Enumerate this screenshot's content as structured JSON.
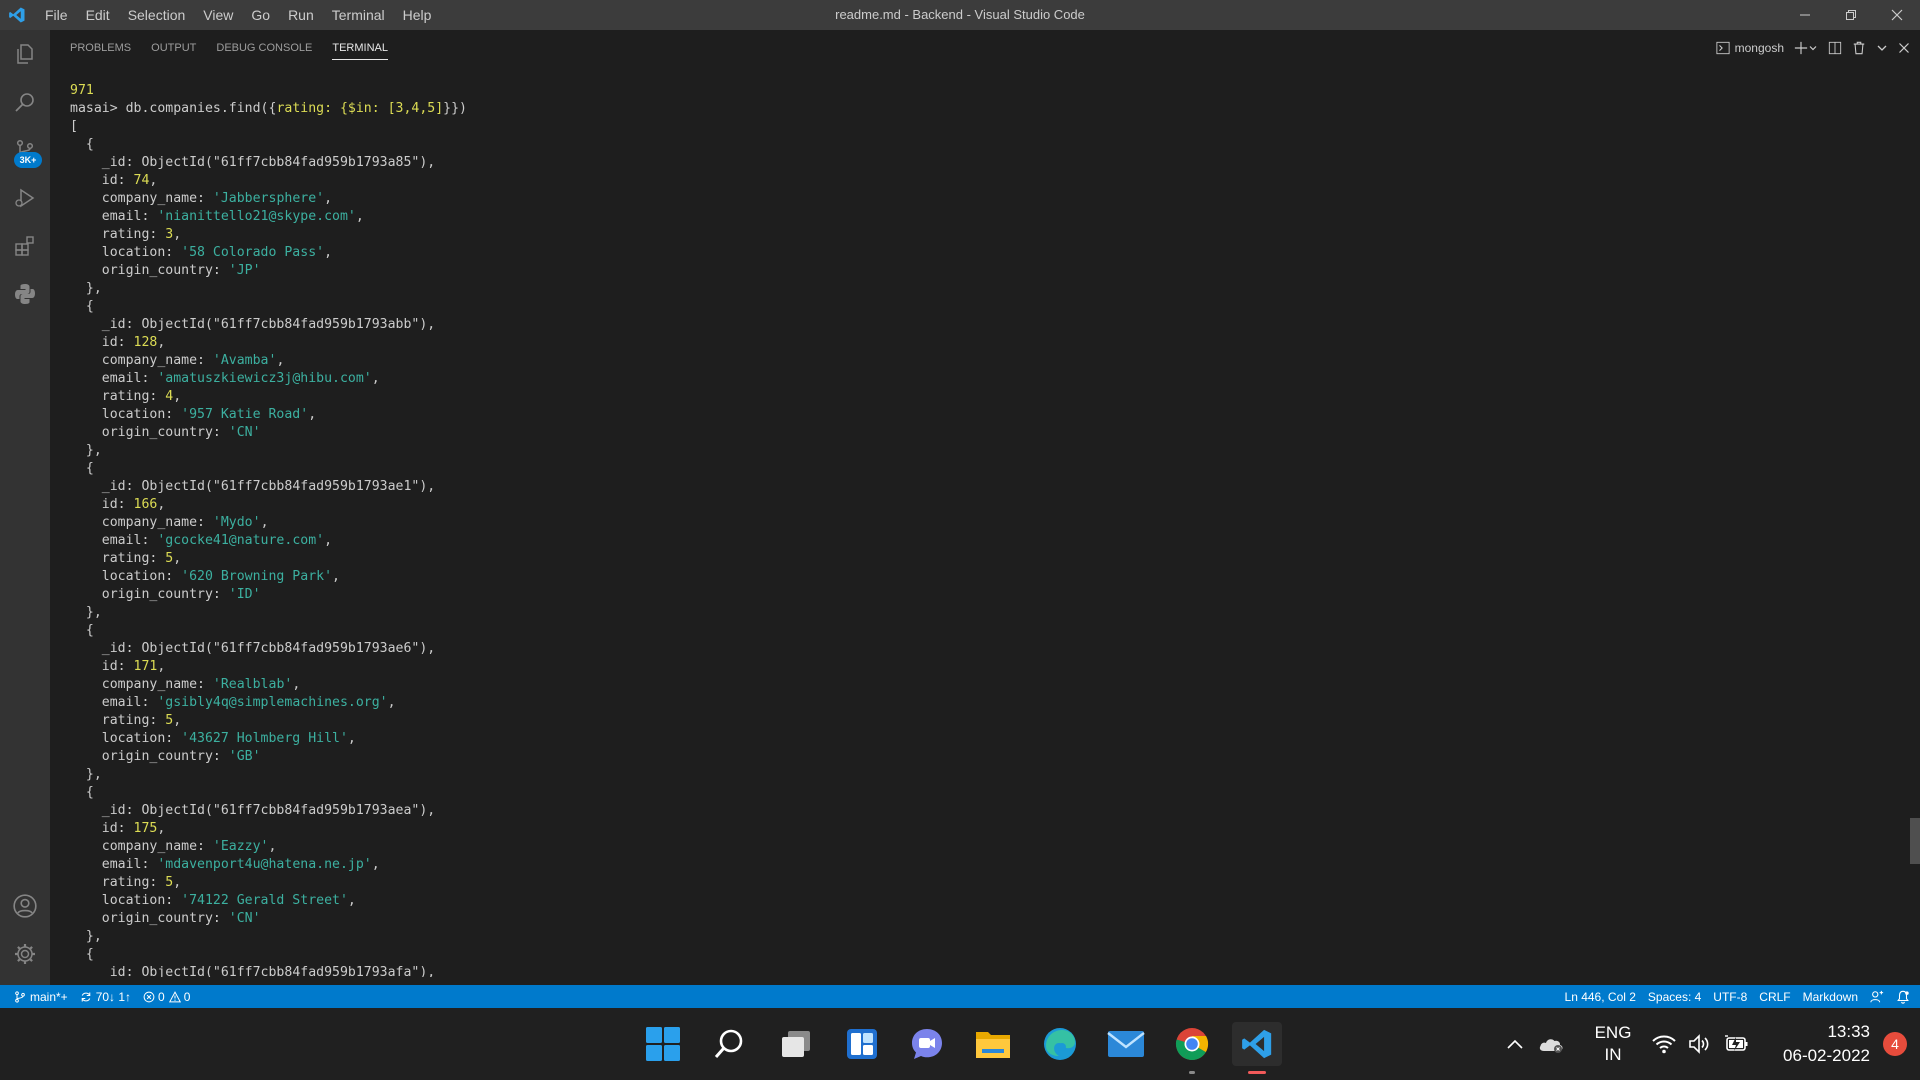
{
  "window": {
    "title": "readme.md - Backend - Visual Studio Code",
    "menu": [
      "File",
      "Edit",
      "Selection",
      "View",
      "Go",
      "Run",
      "Terminal",
      "Help"
    ]
  },
  "activitybar": {
    "items": [
      "explorer-icon",
      "search-icon",
      "source-control-icon",
      "run-debug-icon",
      "extensions-icon",
      "python-icon"
    ],
    "scm_badge": "3K+",
    "bottom": [
      "accounts-icon",
      "manage-gear-icon"
    ]
  },
  "panel": {
    "tabs": [
      "PROBLEMS",
      "OUTPUT",
      "DEBUG CONSOLE",
      "TERMINAL"
    ],
    "active_tab": "TERMINAL",
    "terminal_name": "mongosh"
  },
  "terminal": {
    "prev_count": "971",
    "prompt": "masai> ",
    "command": "db.companies.find({rating: {$in: [3,4,5]}})",
    "records": [
      {
        "oid": "61ff7cbb84fad959b1793a85",
        "id": "74",
        "company_name": "Jabbersphere",
        "email": "nianittello21@skype.com",
        "rating": "3",
        "location": "58 Colorado Pass",
        "origin_country": "JP"
      },
      {
        "oid": "61ff7cbb84fad959b1793abb",
        "id": "128",
        "company_name": "Avamba",
        "email": "amatuszkiewicz3j@hibu.com",
        "rating": "4",
        "location": "957 Katie Road",
        "origin_country": "CN"
      },
      {
        "oid": "61ff7cbb84fad959b1793ae1",
        "id": "166",
        "company_name": "Mydo",
        "email": "gcocke41@nature.com",
        "rating": "5",
        "location": "620 Browning Park",
        "origin_country": "ID"
      },
      {
        "oid": "61ff7cbb84fad959b1793ae6",
        "id": "171",
        "company_name": "Realblab",
        "email": "gsibly4q@simplemachines.org",
        "rating": "5",
        "location": "43627 Holmberg Hill",
        "origin_country": "GB"
      },
      {
        "oid": "61ff7cbb84fad959b1793aea",
        "id": "175",
        "company_name": "Eazzy",
        "email": "mdavenport4u@hatena.ne.jp",
        "rating": "5",
        "location": "74122 Gerald Street",
        "origin_country": "CN"
      }
    ],
    "last_oid": "61ff7cbb84fad959b1793afa"
  },
  "statusbar": {
    "branch": "main*+",
    "sync": "70↓ 1↑",
    "errors": "0",
    "warnings": "0",
    "position": "Ln 446, Col 2",
    "spaces": "Spaces: 4",
    "encoding": "UTF-8",
    "eol": "CRLF",
    "language": "Markdown"
  },
  "taskbar": {
    "apps": [
      "windows-start-icon",
      "search-icon",
      "task-view-icon",
      "widgets-icon",
      "teams-chat-icon",
      "file-explorer-icon",
      "edge-icon",
      "mail-icon",
      "chrome-icon",
      "vscode-icon"
    ],
    "lang_line1": "ENG",
    "lang_line2": "IN",
    "time": "13:33",
    "date": "06-02-2022",
    "notifications": "4"
  },
  "colors": {
    "statusbar": "#007acc",
    "titlebar": "#3c3c3c",
    "activitybar": "#333333",
    "terminal_bg": "#1e1e1e",
    "number": "#dcdc54",
    "string": "#3cb0a0"
  }
}
